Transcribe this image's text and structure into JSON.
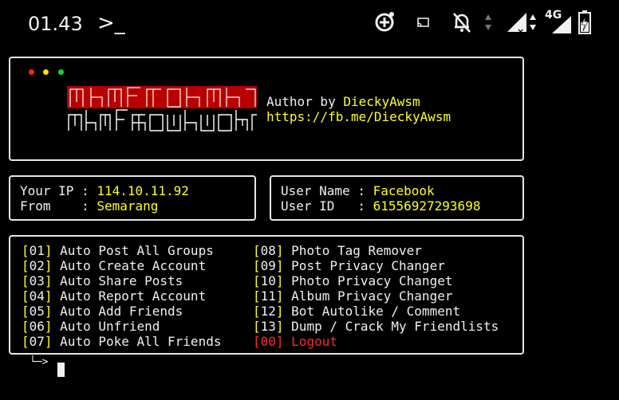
{
  "status_bar": {
    "time": "01.43",
    "prompt_glyph": ">_",
    "network_label": "4G",
    "icons": [
      "add-circle-icon",
      "cast-icon",
      "notifications-off-icon",
      "signal-icon",
      "signal-icon",
      "battery-charging-icon"
    ]
  },
  "banner": {
    "author_label": "Author by ",
    "author_name": "DieckyAwsm",
    "url": "https://fb.me/DieckyAwsm",
    "dot_colors": [
      "#ff2020",
      "#ffe000",
      "#20d020"
    ]
  },
  "ip_box": {
    "ip_label": "Your IP : ",
    "ip_value": "114.10.11.92",
    "from_label": "From    : ",
    "from_value": "Semarang"
  },
  "user_box": {
    "name_label": "User Name : ",
    "name_value": "Facebook",
    "id_label": "User ID   : ",
    "id_value": "61556927293698"
  },
  "menu": {
    "left": [
      {
        "num": "01",
        "label": "Auto Post All Groups"
      },
      {
        "num": "02",
        "label": "Auto Create Account"
      },
      {
        "num": "03",
        "label": "Auto Share Posts"
      },
      {
        "num": "04",
        "label": "Auto Report Account"
      },
      {
        "num": "05",
        "label": "Auto Add Friends"
      },
      {
        "num": "06",
        "label": "Auto Unfriend"
      },
      {
        "num": "07",
        "label": "Auto Poke All Friends"
      }
    ],
    "right": [
      {
        "num": "08",
        "label": "Photo Tag Remover"
      },
      {
        "num": "09",
        "label": "Post Privacy Changer"
      },
      {
        "num": "10",
        "label": "Photo Privacy Changet"
      },
      {
        "num": "11",
        "label": "Album Privacy Changer"
      },
      {
        "num": "12",
        "label": "Bot Autolike / Comment"
      },
      {
        "num": "13",
        "label": "Dump / Crack My Friendlists"
      },
      {
        "num": "00",
        "label": "Logout"
      }
    ]
  },
  "input_prompt": "└─>"
}
